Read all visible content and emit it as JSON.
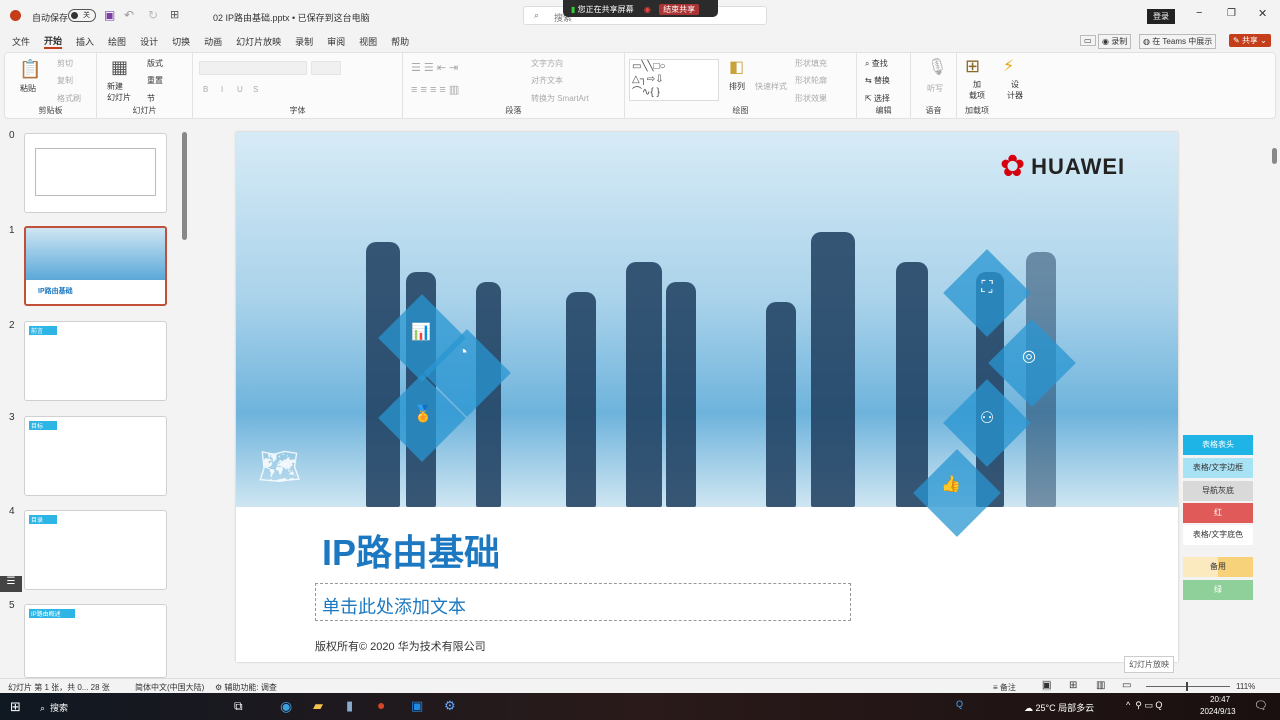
{
  "titlebar": {
    "autosave_label": "自动保存",
    "autosave_state": "关",
    "filename": "02 IP路由基础.pptx • 已保存到这台电脑",
    "search_placeholder": "搜索",
    "share_banner": "您正在共享屏幕",
    "stop_share": "结束共享",
    "signin": "登录"
  },
  "tabs": [
    "文件",
    "开始",
    "插入",
    "绘图",
    "设计",
    "切换",
    "动画",
    "幻灯片放映",
    "录制",
    "审阅",
    "视图",
    "帮助"
  ],
  "tab_actions": {
    "comments": "",
    "record": "录制",
    "teams": "在 Teams 中展示",
    "share": "共享"
  },
  "ribbon": {
    "clipboard": {
      "label": "剪贴板",
      "paste": "粘贴",
      "cut": "剪切",
      "copy": "复制",
      "format_painter": "格式刷"
    },
    "slides": {
      "label": "幻灯片",
      "new_slide": "新建\n幻灯片",
      "layout": "版式",
      "reset": "重置",
      "section": "节"
    },
    "font": {
      "label": "字体",
      "bold": "B",
      "italic": "I",
      "underline": "U",
      "shadow": "S"
    },
    "paragraph": {
      "label": "段落",
      "text_direction": "文字方向",
      "align_text": "对齐文本",
      "smartart": "转换为 SmartArt"
    },
    "drawing": {
      "label": "绘图",
      "arrange": "排列",
      "quick_styles": "快速样式",
      "shape_fill": "形状填充",
      "shape_outline": "形状轮廓",
      "shape_effects": "形状效果"
    },
    "editing": {
      "label": "编辑",
      "find": "查找",
      "replace": "替换",
      "select": "选择"
    },
    "voice": {
      "label": "语音",
      "dictate": "听写"
    },
    "addins": {
      "label": "加载项",
      "addins": "加\n载项",
      "designer": "设\n计器"
    }
  },
  "thumbnails": [
    {
      "num": "0"
    },
    {
      "num": "1",
      "title": "IP路由基础"
    },
    {
      "num": "2",
      "title": "前言"
    },
    {
      "num": "3",
      "title": "目标"
    },
    {
      "num": "4",
      "title": "目录"
    },
    {
      "num": "5",
      "title": "IP路由概述"
    }
  ],
  "slide": {
    "brand": "HUAWEI",
    "title": "IP路由基础",
    "subtitle_placeholder": "单击此处添加文本",
    "copyright": "版权所有© 2020 华为技术有限公司"
  },
  "palette": [
    {
      "label": "表格表头",
      "color": "#1eb4e6"
    },
    {
      "label": "表格/文字边框",
      "color": "#a8e2f5"
    },
    {
      "label": "导航灰底",
      "color": "#d9d9d9"
    },
    {
      "label": "红",
      "color": "#e05a5a"
    },
    {
      "label": "表格/文字底色",
      "color": "#ffffff"
    },
    {
      "label": "备用",
      "color": "#f8d890"
    },
    {
      "label": "绿",
      "color": "#8fd09a"
    }
  ],
  "tooltip": "幻灯片放映",
  "statusbar": {
    "slide_info": "幻灯片 第 1 张，共 0... 28 张",
    "language": "简体中文(中国大陆)",
    "accessibility": "辅助功能: 调查",
    "notes": "备注",
    "zoom": "111%"
  },
  "taskbar": {
    "search": "搜索",
    "weather": "25°C 局部多云",
    "time": "20:47",
    "date": "2024/9/13"
  }
}
